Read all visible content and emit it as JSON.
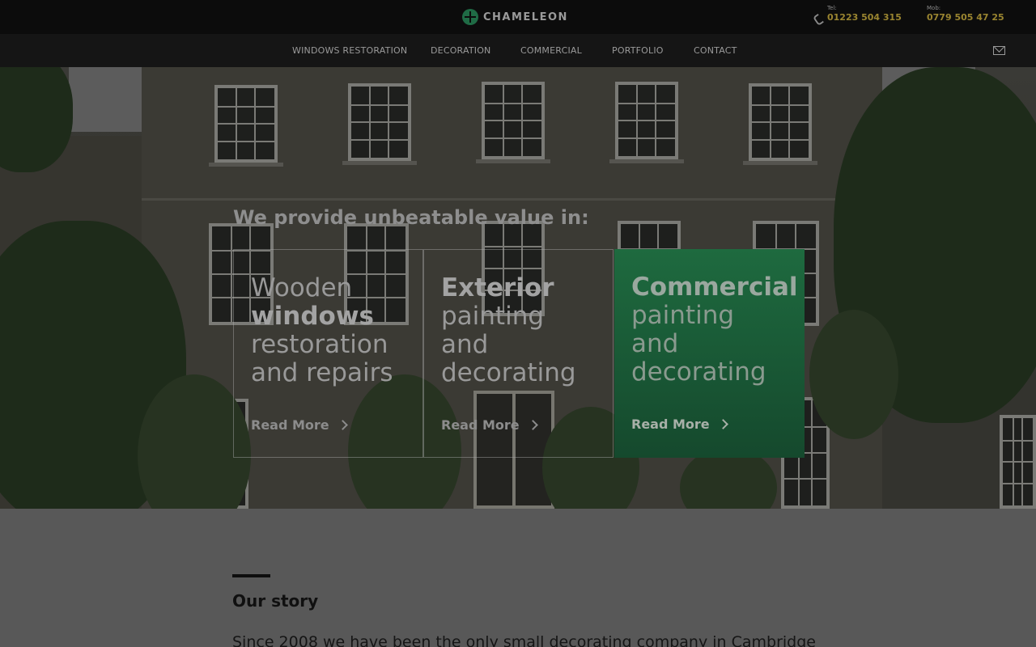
{
  "brand": {
    "name": "CHAMELEON",
    "logo_icon": "chameleon-logo-icon"
  },
  "contact": {
    "tel_label": "Tel:",
    "tel_number": "01223 504 315",
    "mob_label": "Mob:",
    "mob_number": "0779 505 47 25",
    "phone_icon": "phone-icon"
  },
  "nav": {
    "items": [
      {
        "label": "WINDOWS RESTORATION"
      },
      {
        "label": "DECORATION"
      },
      {
        "label": "COMMERCIAL"
      },
      {
        "label": "PORTFOLIO"
      },
      {
        "label": "CONTACT"
      }
    ],
    "mail_icon": "mail-icon"
  },
  "hero": {
    "heading": "We provide unbeatable value in:",
    "cards": [
      {
        "lines": [
          "Wooden",
          "windows",
          "restoration",
          "and repairs"
        ],
        "bold": [
          1
        ],
        "cta": "Read More",
        "highlighted": false
      },
      {
        "lines": [
          "Exterior",
          "painting",
          "and",
          "decorating"
        ],
        "bold": [
          0
        ],
        "cta": "Read More",
        "highlighted": false
      },
      {
        "lines": [
          "Commercial",
          "painting",
          "and",
          "decorating"
        ],
        "bold": [
          0
        ],
        "cta": "Read More",
        "highlighted": true
      }
    ]
  },
  "story": {
    "title": "Our story",
    "text": "Since 2008 we have been the only small decorating company in Cambridge"
  },
  "colors": {
    "accent_green": "#1e6a3f",
    "phone_gold": "#9a8530",
    "topbar": "#0c0c0c",
    "navbar": "#151515"
  }
}
